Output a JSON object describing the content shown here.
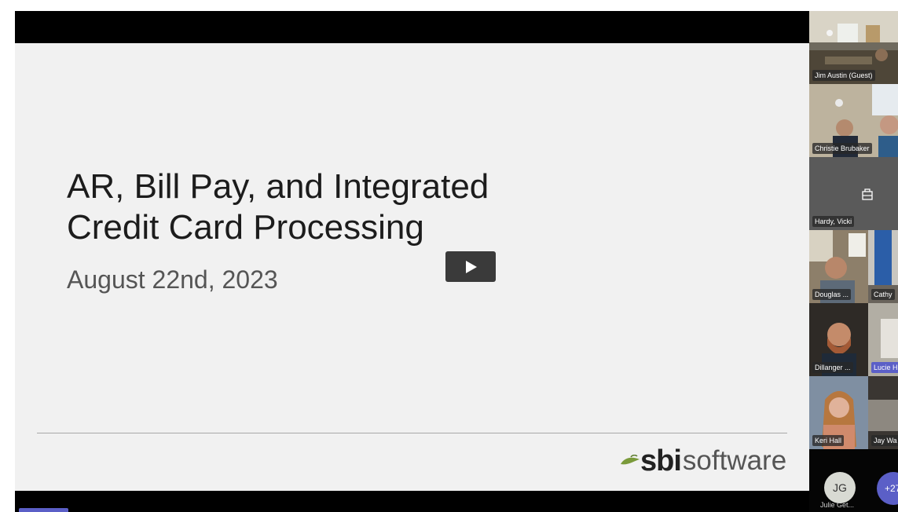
{
  "slide": {
    "title": "AR, Bill Pay, and Integrated\nCredit Card Processing",
    "date": "August 22nd, 2023",
    "logo_bold": "sbi",
    "logo_light": "software"
  },
  "controls": {
    "play_icon": "play-icon"
  },
  "participants": [
    {
      "name": "Jim Austin (Guest)"
    },
    {
      "name": "Christie Brubaker"
    },
    {
      "name": "Hardy, Vicki",
      "icon": "bag-icon"
    },
    {
      "name": "Douglas ..."
    },
    {
      "name": "Cathy"
    },
    {
      "name": "Dillanger ..."
    },
    {
      "name": "Lucie H"
    },
    {
      "name": "Keri Hall"
    },
    {
      "name": "Jay Wa"
    },
    {
      "name": "Julie Get...",
      "initials": "JG"
    }
  ],
  "overflow": {
    "count_label": "+27"
  },
  "colors": {
    "accent": "#5b5fc7",
    "slide_bg": "#f1f1f1",
    "logo_leaf": "#7a9a3a"
  }
}
